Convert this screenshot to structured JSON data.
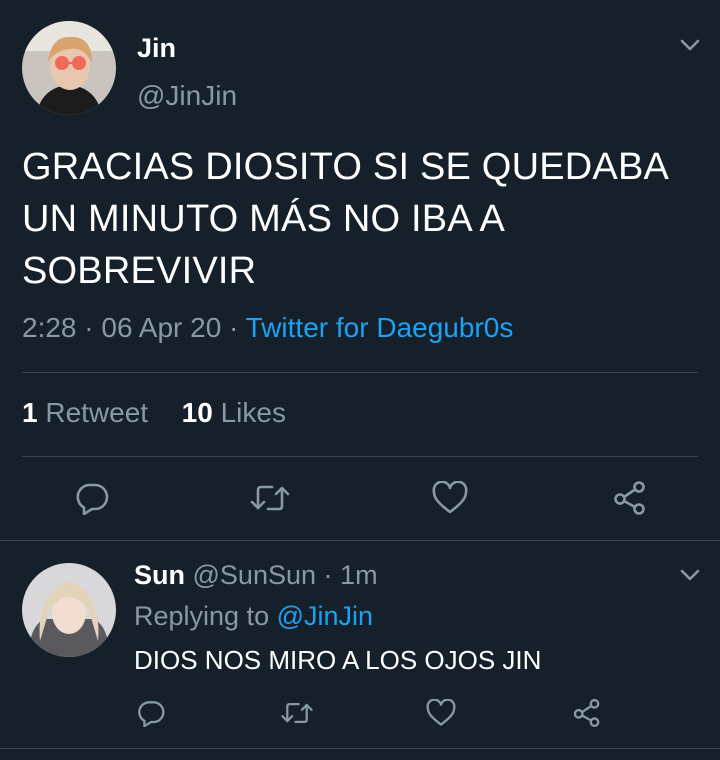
{
  "tweet": {
    "author_name": "Jin",
    "author_handle": "@JinJin",
    "text": "GRACIAS DIOSITO SI SE QUEDABA UN MINUTO MÁS NO IBA A SOBREVIVIR",
    "time": "2:28",
    "date": "06 Apr 20",
    "separator": "·",
    "source": "Twitter for Daegubr0s",
    "retweets_count": "1",
    "retweets_label": "Retweet",
    "likes_count": "10",
    "likes_label": "Likes"
  },
  "reply": {
    "author_name": "Sun",
    "author_handle": "@SunSun",
    "age": "1m",
    "replying_prefix": "Replying to",
    "replying_handle": "@JinJin",
    "text": "DIOS NOS MIRO A LOS OJOS JIN"
  },
  "colors": {
    "background": "#15202b",
    "secondary_text": "#8899a6",
    "link": "#1da1f2",
    "divider": "#38444d"
  },
  "icons": [
    "chevron-down-icon",
    "reply-icon",
    "retweet-icon",
    "like-icon",
    "share-icon"
  ]
}
